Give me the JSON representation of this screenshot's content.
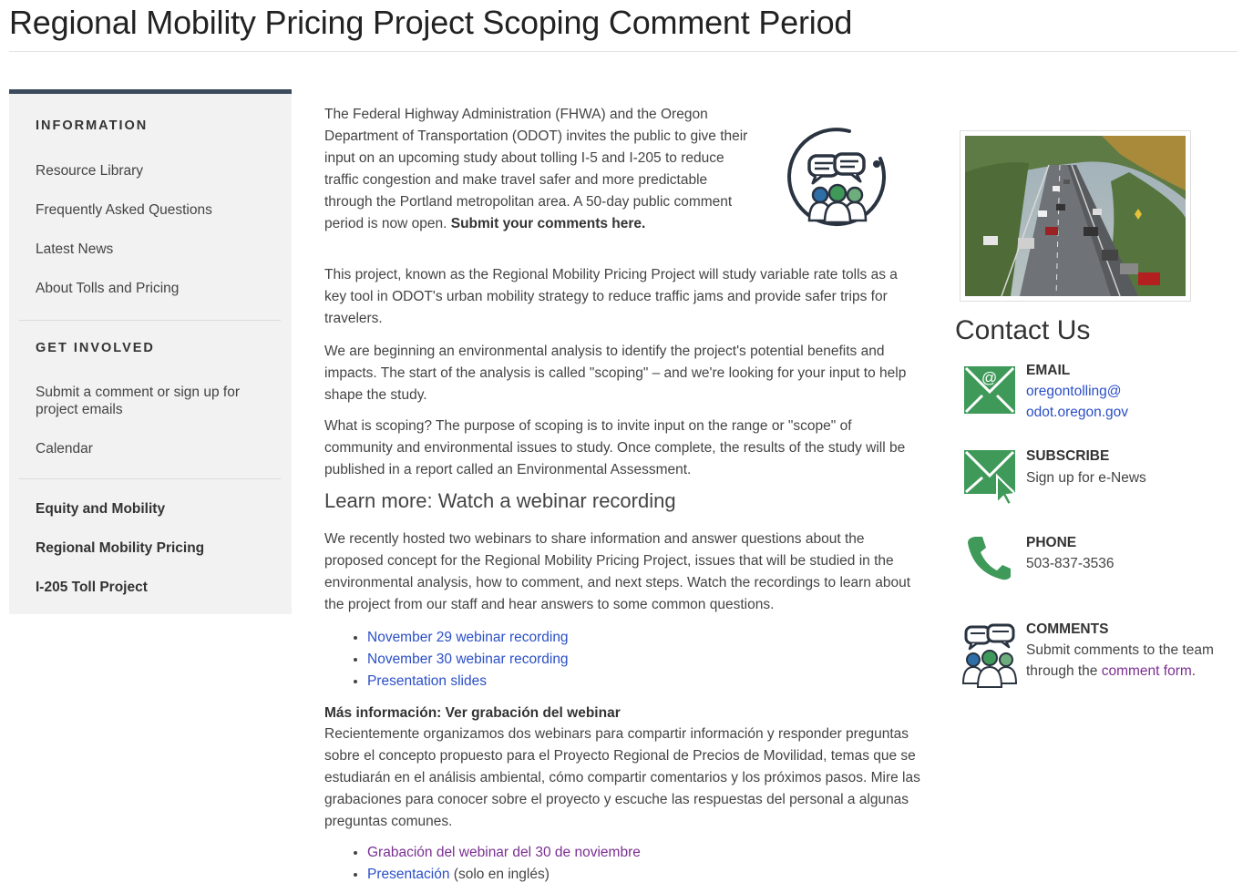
{
  "page": {
    "title": "Regional Mobility Pricing Project Scoping Comment Period"
  },
  "sidebar": {
    "information_heading": "INFORMATION",
    "information_items": [
      "Resource Library",
      "Frequently Asked Questions",
      "Latest News",
      "About Tolls and Pricing"
    ],
    "get_involved_heading": "GET INVOLVED",
    "get_involved_items": [
      "Submit a comment or sign up for project emails",
      "Calendar"
    ],
    "bold_items": [
      "Equity and Mobility",
      "Regional Mobility Pricing",
      "I-205 Toll Project"
    ]
  },
  "main": {
    "intro_text": "The Federal Highway Administration (FHWA) and the Oregon Department of Transportation (ODOT) invites the public to give their input on an upcoming study about tolling I-5 and I-205 to reduce traffic congestion and make travel safer and more predictable through the Portland metropolitan area. A 50-day public comment period is now open.",
    "intro_cta_bold": "Submit your comments",
    "intro_cta_link": "here.",
    "para2": "This project, known as the Regional Mobility Pricing Project will study variable rate tolls as a key tool in ODOT's urban mobility strategy to reduce traffic jams and provide safer trips for travelers.",
    "para3": "We are beginning an environmental analysis to identify the project's potential benefits and impacts. The start of the analysis is called \"scoping\" – and we're looking for your input to help shape the study.",
    "para4": "What is scoping? The purpose of scoping is to invite input on the range or \"scope\" of community and environmental issues to study. Once complete, the results of the study will be published in a report called an Environmental Assessment.",
    "learn_heading": "Learn more: Watch a webinar recording",
    "para5": "We recently hosted two webinars to share information and answer questions about the proposed concept for the Regional Mobility Pricing Project, issues that will be studied in the environmental analysis, how to comment, and next steps. Watch the recordings to learn about the project from our staff and hear answers to some common questions.",
    "english_links": [
      "November 29 webinar recording",
      "November 30 webinar recording",
      "Presentation slides"
    ],
    "spanish_heading": "Más información: Ver grabación del webinar",
    "spanish_text": "Recientemente organizamos dos webinars para compartir información y responder preguntas sobre el concepto propuesto para el Proyecto Regional de Precios de Movilidad, temas que se estudiarán en el análisis ambiental, cómo compartir comentarios y los próximos pasos. Mire las grabaciones para conocer sobre el proyecto y escuche las respuestas del personal a algunas preguntas comunes.",
    "spanish_link1": "Grabación del webinar del 30 de noviembre",
    "spanish_link2": "Presentación",
    "spanish_link2_suffix": " (solo en inglés)"
  },
  "contact": {
    "title": "Contact Us",
    "email_label": "EMAIL",
    "email_line1": "oregontolling@",
    "email_line2": "odot.oregon.gov",
    "subscribe_label": "SUBSCRIBE",
    "subscribe_link": "Sign up for e-News",
    "phone_label": "PHONE",
    "phone_number": "503-837-3536",
    "comments_label": "COMMENTS",
    "comments_text_prefix": "Submit comments to the team through the ",
    "comments_link": "comment form",
    "comments_text_suffix": "."
  },
  "icons": {
    "comments": "comment-group-icon",
    "email": "envelope-at-icon",
    "subscribe": "envelope-cursor-icon",
    "phone": "phone-icon"
  },
  "colors": {
    "link_blue": "#2b4fc7",
    "link_purple": "#7a2f91",
    "icon_green": "#3f9a5a",
    "sidebar_bg": "#f2f2f2",
    "sidebar_top_border": "#3b4a5c"
  }
}
